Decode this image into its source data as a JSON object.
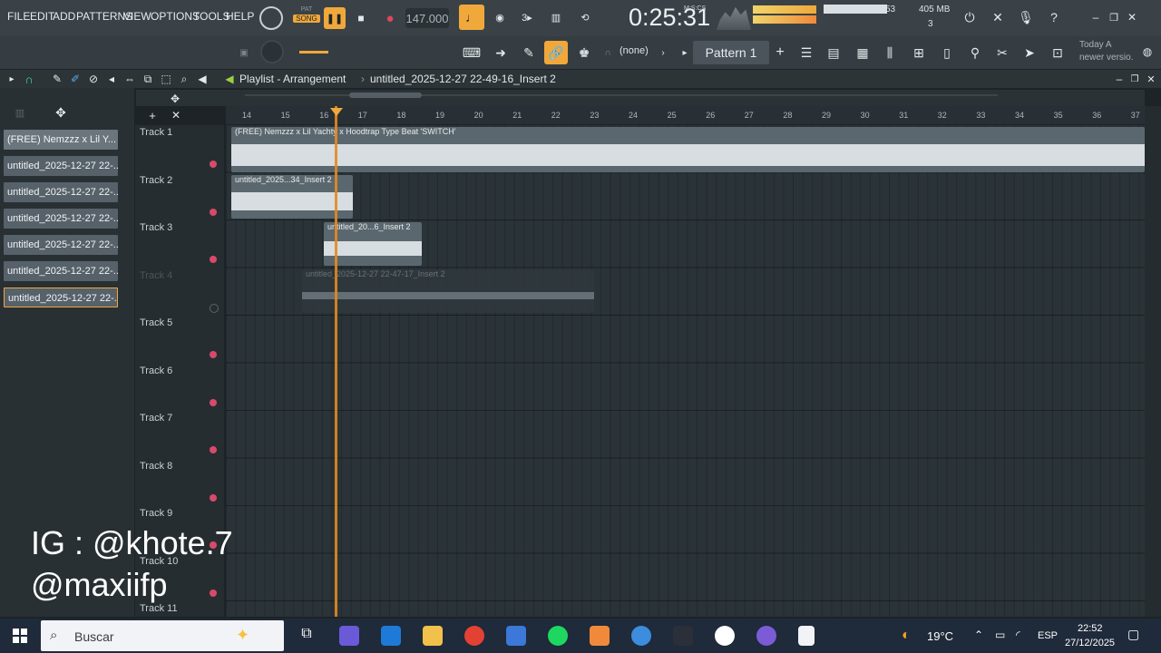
{
  "menu": [
    "FILE",
    "EDIT",
    "ADD",
    "PATTERNS",
    "VIEW",
    "OPTIONS",
    "TOOLS",
    "HELP"
  ],
  "transport": {
    "pat_label": "PAT",
    "song_label": "SONG",
    "tempo": "147.000",
    "time": "0:25:31",
    "time_unit": "M:S:CS"
  },
  "monitor": {
    "cpu": "53",
    "memory": "405 MB",
    "voices": "3"
  },
  "toolbar2": {
    "pattern": "Pattern 1",
    "snap": "(none)",
    "news_line1": "Today  A",
    "news_line2": "newer versio."
  },
  "playlist": {
    "title": "Playlist - Arrangement",
    "arrow": "›",
    "clip_name": "untitled_2025-12-27 22-49-16_Insert 2"
  },
  "picker_items": [
    "(FREE) Nemzzz x Lil Y...",
    "untitled_2025-12-27 22-...",
    "untitled_2025-12-27 22-...",
    "untitled_2025-12-27 22-...",
    "untitled_2025-12-27 22-...",
    "untitled_2025-12-27 22-...",
    "untitled_2025-12-27 22-..."
  ],
  "ruler_ticks": [
    "14",
    "15",
    "16",
    "17",
    "18",
    "19",
    "20",
    "21",
    "22",
    "23",
    "24",
    "25",
    "26",
    "27",
    "28",
    "29",
    "30",
    "31",
    "32",
    "33",
    "34",
    "35",
    "36",
    "37"
  ],
  "tracks": [
    "Track 1",
    "Track 2",
    "Track 3",
    "Track 4",
    "Track 5",
    "Track 6",
    "Track 7",
    "Track 8",
    "Track 9",
    "Track 10",
    "Track 11"
  ],
  "clips": [
    {
      "title": "(FREE) Nemzzz x Lil Yachty x Hoodtrap Type Beat 'SWITCH'"
    },
    {
      "title": "untitled_2025...34_Insert 2"
    },
    {
      "title": "untitled_20...6_Insert 2"
    },
    {
      "title": "untitled_2025-12-27 22-47-17_Insert 2"
    }
  ],
  "watermark": {
    "line1": "IG : @khote.7",
    "line2": "@maxiifp"
  },
  "taskbar": {
    "search": "Buscar",
    "temp": "19°C",
    "lang": "ESP",
    "time": "22:52",
    "date": "27/12/2025"
  },
  "colors": {
    "accent": "#e38a22",
    "clip_bg": "#5b676e",
    "dot": "#d94a6a"
  }
}
